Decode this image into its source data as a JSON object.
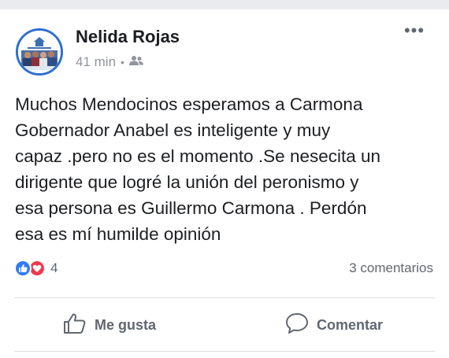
{
  "post": {
    "author": "Nelida Rojas",
    "time": "41 min",
    "separator": "•",
    "audience_icon": "friends-icon",
    "more_label": "•••",
    "text": "Muchos Mendocinos esperamos a Carmona\nGobernador  Anabel es inteligente y muy\ncapaz .pero no es  el momento .Se nesecita un\ndirigente que logré la unión del peronismo y\nesa persona es Guillermo Carmona .  Perdón\nesa es mí humilde opinión",
    "reactions": {
      "types": [
        "like",
        "love"
      ],
      "count": "4"
    },
    "comments_label": "3 comentarios"
  },
  "actions": {
    "like_label": "Me gusta",
    "comment_label": "Comentar"
  },
  "colors": {
    "like": "#2f7cf6",
    "love": "#f0384d",
    "muted_text": "#606770",
    "meta_text": "#90949c",
    "avatar_ring": "#2d6fcf"
  }
}
